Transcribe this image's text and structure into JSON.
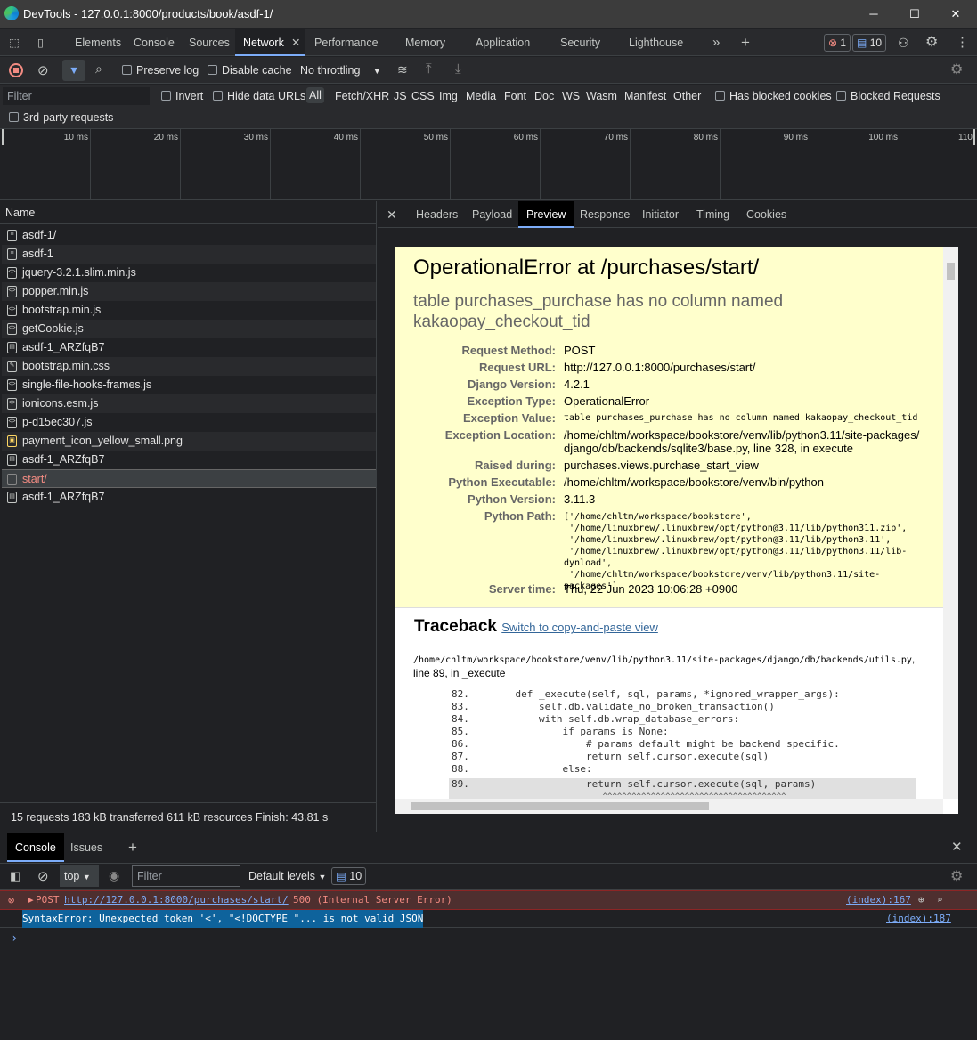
{
  "window": {
    "title": "DevTools - 127.0.0.1:8000/products/book/asdf-1/",
    "minimize": "─",
    "maximize": "☐",
    "close": "✕"
  },
  "tabs": [
    "Elements",
    "Console",
    "Sources",
    "Network",
    "Performance",
    "Memory",
    "Application",
    "Security",
    "Lighthouse"
  ],
  "active_tab": "Network",
  "badges": {
    "errors": "1",
    "messages": "10"
  },
  "toolbar": {
    "preserve_log": "Preserve log",
    "disable_cache": "Disable cache",
    "throttling": "No throttling"
  },
  "filter": {
    "placeholder": "Filter",
    "invert": "Invert",
    "hide_data_urls": "Hide data URLs",
    "types": [
      "All",
      "Fetch/XHR",
      "JS",
      "CSS",
      "Img",
      "Media",
      "Font",
      "Doc",
      "WS",
      "Wasm",
      "Manifest",
      "Other"
    ],
    "has_blocked_cookies": "Has blocked cookies",
    "blocked_requests": "Blocked Requests",
    "third_party": "3rd-party requests"
  },
  "timeline_ticks": [
    "10 ms",
    "20 ms",
    "30 ms",
    "40 ms",
    "50 ms",
    "60 ms",
    "70 ms",
    "80 ms",
    "90 ms",
    "100 ms",
    "110"
  ],
  "requests": {
    "header": "Name",
    "items": [
      "asdf-1/",
      "asdf-1",
      "jquery-3.2.1.slim.min.js",
      "popper.min.js",
      "bootstrap.min.js",
      "getCookie.js",
      "asdf-1_ARZfqB7",
      "bootstrap.min.css",
      "single-file-hooks-frames.js",
      "ionicons.esm.js",
      "p-d15ec307.js",
      "payment_icon_yellow_small.png",
      "asdf-1_ARZfqB7",
      "start/",
      "asdf-1_ARZfqB7"
    ],
    "selected": "start/",
    "status": "15 requests  183 kB transferred  611 kB resources  Finish: 43.81 s"
  },
  "detail_tabs": [
    "Headers",
    "Payload",
    "Preview",
    "Response",
    "Initiator",
    "Timing",
    "Cookies"
  ],
  "active_detail_tab": "Preview",
  "error": {
    "title": "OperationalError at /purchases/start/",
    "subtitle": "table purchases_purchase has no column named kakaopay_checkout_tid",
    "meta": [
      {
        "k": "Request Method:",
        "v": "POST"
      },
      {
        "k": "Request URL:",
        "v": "http://127.0.0.1:8000/purchases/start/"
      },
      {
        "k": "Django Version:",
        "v": "4.2.1"
      },
      {
        "k": "Exception Type:",
        "v": "OperationalError"
      },
      {
        "k": "Exception Value:",
        "v": "table purchases_purchase has no column named kakaopay_checkout_tid"
      },
      {
        "k": "Exception Location:",
        "v": "/home/chltm/workspace/bookstore/venv/lib/python3.11/site-packages/django/db/backends/sqlite3/base.py, line 328, in execute"
      },
      {
        "k": "Raised during:",
        "v": "purchases.views.purchase_start_view"
      },
      {
        "k": "Python Executable:",
        "v": "/home/chltm/workspace/bookstore/venv/bin/python"
      },
      {
        "k": "Python Version:",
        "v": "3.11.3"
      },
      {
        "k": "Python Path:",
        "v": "['/home/chltm/workspace/bookstore',\n '/home/linuxbrew/.linuxbrew/opt/python@3.11/lib/python311.zip',\n '/home/linuxbrew/.linuxbrew/opt/python@3.11/lib/python3.11',\n '/home/linuxbrew/.linuxbrew/opt/python@3.11/lib/python3.11/lib-dynload',\n '/home/chltm/workspace/bookstore/venv/lib/python3.11/site-packages']"
      },
      {
        "k": "Server time:",
        "v": "Thu, 22 Jun 2023 10:06:28 +0900"
      }
    ],
    "traceback_title": "Traceback",
    "traceback_link": "Switch to copy-and-paste view",
    "frame_file": "/home/chltm/workspace/bookstore/venv/lib/python3.11/site-packages/django/db/backends/utils.py",
    "frame_loc": ", line 89, in _execute",
    "code": [
      {
        "n": "82.",
        "c": "    def _execute(self, sql, params, *ignored_wrapper_args):"
      },
      {
        "n": "83.",
        "c": "        self.db.validate_no_broken_transaction()"
      },
      {
        "n": "84.",
        "c": "        with self.db.wrap_database_errors:"
      },
      {
        "n": "85.",
        "c": "            if params is None:"
      },
      {
        "n": "86.",
        "c": "                # params default might be backend specific."
      },
      {
        "n": "87.",
        "c": "                return self.cursor.execute(sql)"
      },
      {
        "n": "88.",
        "c": "            else:"
      },
      {
        "n": "89.",
        "c": "                return self.cursor.execute(sql, params)"
      },
      {
        "n": "",
        "c": "                       ^^^^^^^^^^^^^^^^^^^^^^^^^^^^^^^^^^^^^^"
      }
    ]
  },
  "console": {
    "tabs": [
      "Console",
      "Issues"
    ],
    "context": "top",
    "filter_placeholder": "Filter",
    "levels": "Default levels",
    "count": "10",
    "msg1_method": "POST",
    "msg1_url": "http://127.0.0.1:8000/purchases/start/",
    "msg1_status": "500 (Internal Server Error)",
    "msg1_src": "(index):167",
    "msg2": "SyntaxError: Unexpected token '<', \"<!DOCTYPE \"... is not valid JSON",
    "msg2_src": "(index):187",
    "prompt": "›"
  }
}
